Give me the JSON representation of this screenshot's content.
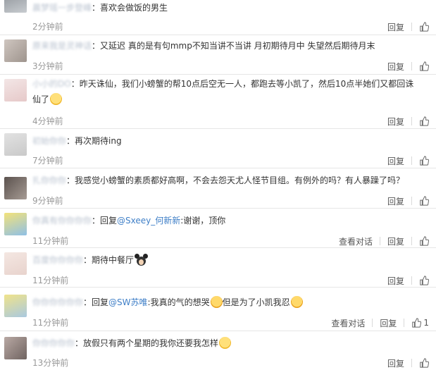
{
  "comments": [
    {
      "username": "晨梦瑶一步登峰",
      "body": "喜欢会做饭的男生",
      "time": "2分钟前",
      "reply": "回复"
    },
    {
      "username": "原来我是灵神话",
      "body": "又延迟 真的是有句mmp不知当讲不当讲 月初期待月中 失望然后期待月末",
      "time": "3分钟前",
      "reply": "回复"
    },
    {
      "username": "小小的DO",
      "body": "昨天诛仙，我们小螃蟹的帮10点后空无一人，都跑去等小凯了，然后10点半她们又都回诛仙了",
      "time": "4分钟前",
      "reply": "回复"
    },
    {
      "username": "初始你你",
      "body": "再次期待ing",
      "time": "7分钟前",
      "reply": "回复"
    },
    {
      "username": "扎你你你",
      "body": "我感觉小螃蟹的素质都好高啊，不会去怨天尤人怪节目组。有例外的吗？有人暴躁了吗？",
      "time": "9分钟前",
      "reply": "回复"
    },
    {
      "username": "你真有你你你你",
      "body_prefix": "回复",
      "mention": "@Sxeey_何新新",
      "body": ":谢谢，顶你",
      "time": "11分钟前",
      "view": "查看对话",
      "reply": "回复"
    },
    {
      "username": "百度你你你你",
      "body": "期待中餐厅",
      "time": "11分钟前",
      "reply": "回复"
    },
    {
      "username": "你你你你你你",
      "body_prefix": "回复",
      "mention": "@SW苏唯",
      "body": ":我真的气的想哭",
      "body2": "但是为了小凯我忍",
      "time": "11分钟前",
      "view": "查看对话",
      "reply": "回复",
      "likes": "1"
    },
    {
      "username": "你你你你你",
      "body": "放假只有两个星期的我你还要我怎样",
      "time": "13分钟前",
      "reply": "回复"
    }
  ],
  "colors": {
    "mention": "#3f7fc7",
    "time": "#999999",
    "separator": "#e6e6e6"
  }
}
